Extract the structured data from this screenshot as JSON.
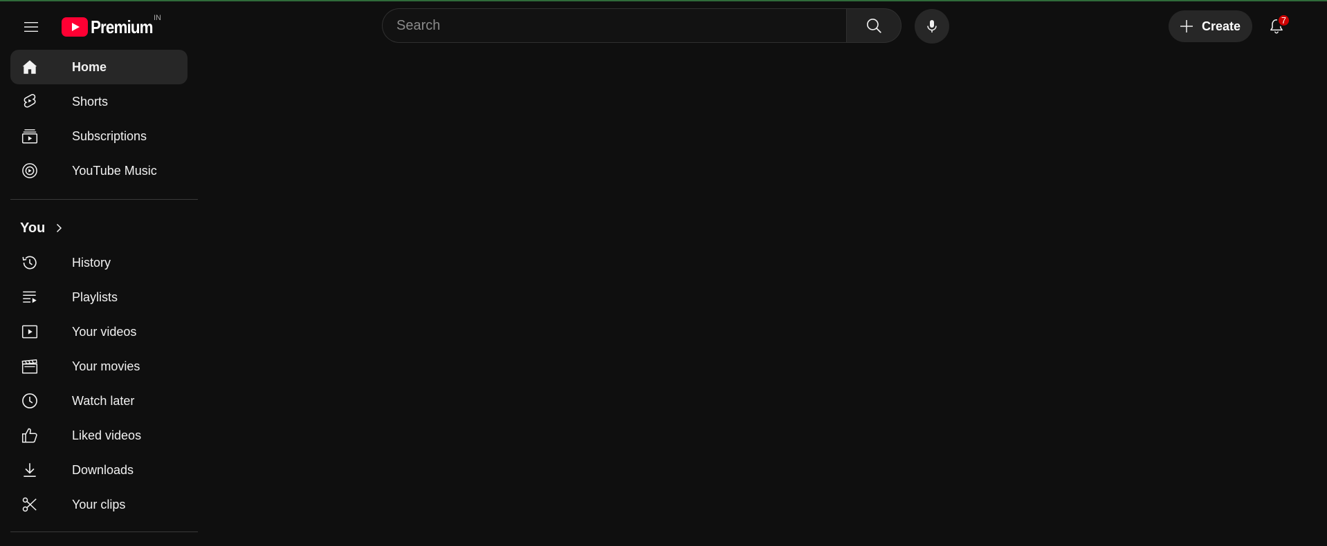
{
  "masthead": {
    "logo_text": "Premium",
    "country_code": "IN",
    "search": {
      "placeholder": "Search"
    },
    "create_label": "Create",
    "notification_count": "7"
  },
  "colors": {
    "background": "#0f0f0f",
    "brand_red": "#ff0033",
    "badge_red": "#cc0000",
    "active_item_bg": "#272727"
  },
  "sidebar": {
    "main": [
      {
        "label": "Home",
        "icon": "home-icon",
        "active": true
      },
      {
        "label": "Shorts",
        "icon": "shorts-icon"
      },
      {
        "label": "Subscriptions",
        "icon": "subscriptions-icon"
      },
      {
        "label": "YouTube Music",
        "icon": "music-icon"
      }
    ],
    "you_label": "You",
    "you": [
      {
        "label": "History",
        "icon": "history-icon"
      },
      {
        "label": "Playlists",
        "icon": "playlists-icon"
      },
      {
        "label": "Your videos",
        "icon": "your-videos-icon"
      },
      {
        "label": "Your movies",
        "icon": "movies-icon"
      },
      {
        "label": "Watch later",
        "icon": "clock-icon"
      },
      {
        "label": "Liked videos",
        "icon": "thumbs-up-icon"
      },
      {
        "label": "Downloads",
        "icon": "download-icon"
      },
      {
        "label": "Your clips",
        "icon": "scissors-icon"
      }
    ]
  }
}
